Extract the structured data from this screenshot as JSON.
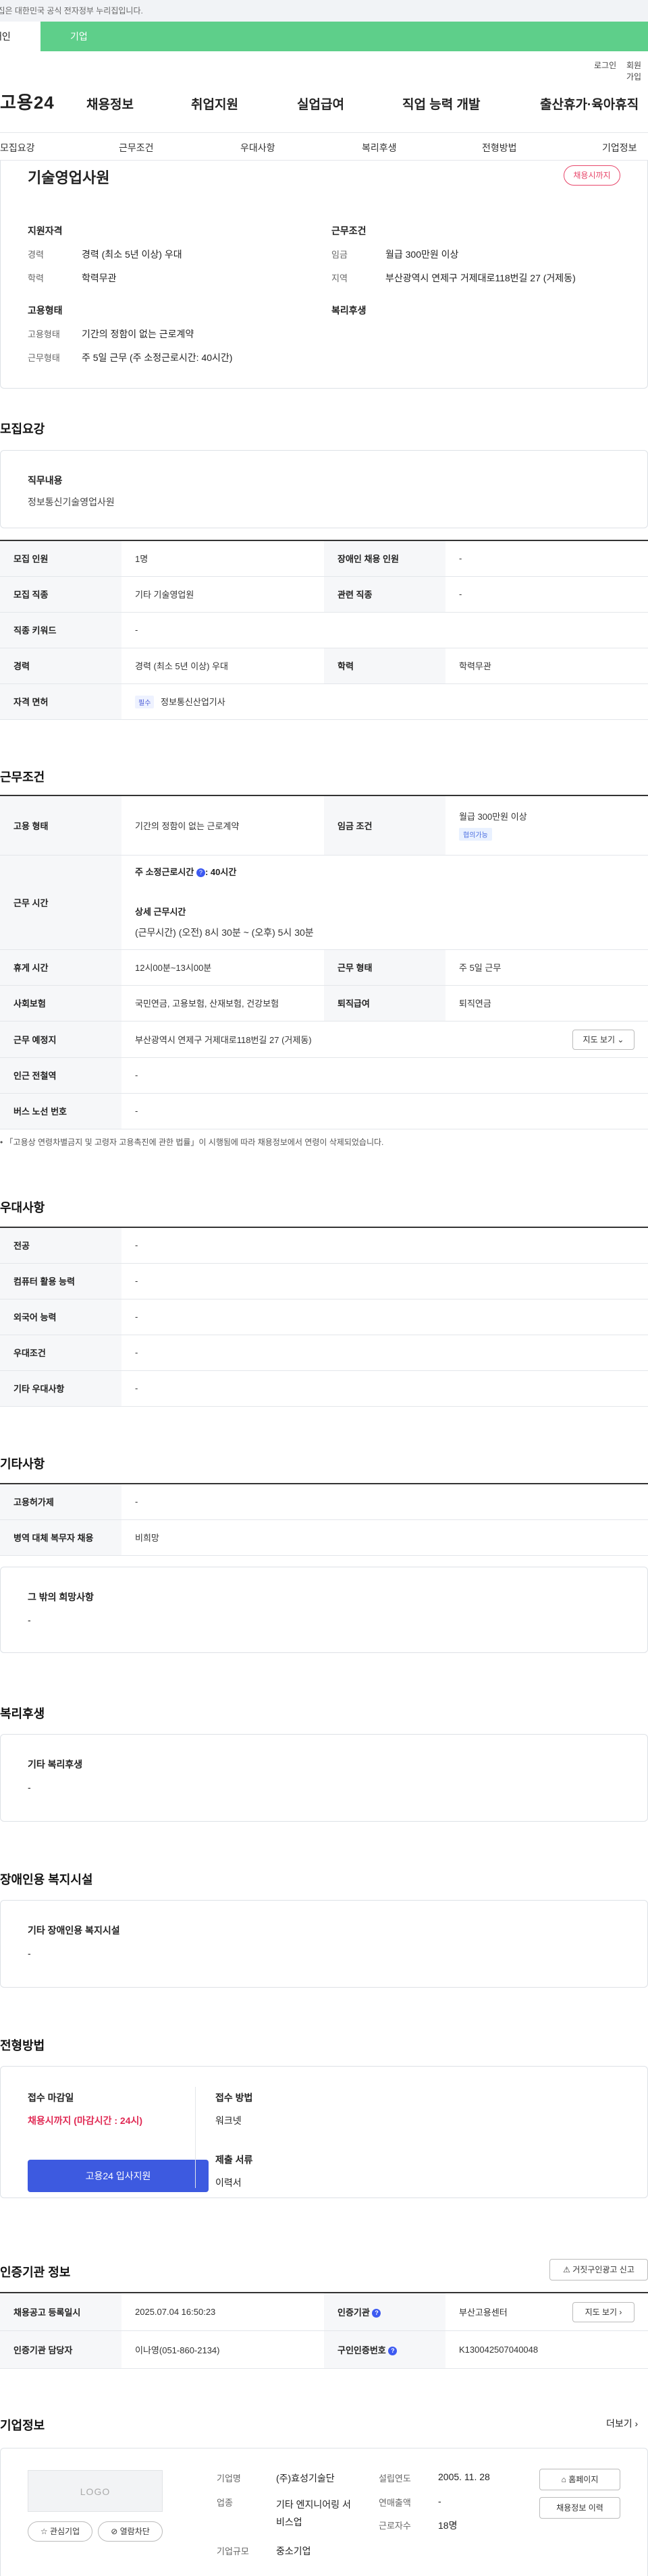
{
  "top": {
    "notice": "이 누리집은 대한민국 공식 전자정부 누리집입니다.",
    "switch_left": "개인",
    "switch_right": "기업"
  },
  "util": {
    "login": "로그인",
    "join": "회원가입"
  },
  "header": {
    "logo": "고용24",
    "nav": [
      "채용정보",
      "취업지원",
      "실업급여",
      "직업 능력 개발",
      "출산휴가·육아휴직"
    ]
  },
  "subnav": [
    "모집요강",
    "근무조건",
    "우대사항",
    "복리후생",
    "전형방법",
    "기업정보"
  ],
  "summary": {
    "title": "기술영업사원",
    "status_badge": "채용시까지",
    "qualification_heading": "지원자격",
    "career_label": "경력",
    "career_value": "경력 (최소 5년 이상) 우대",
    "education_label": "학력",
    "education_value": "학력무관",
    "condition_heading": "근무조건",
    "wage_label": "임금",
    "wage_value": "월급 300만원 이상",
    "region_label": "지역",
    "region_value": "부산광역시 연제구 거제대로118번길 27 (거제동)",
    "employment_heading": "고용형태",
    "emp_type_label": "고용형태",
    "emp_type_value": "기간의 정함이 없는 근로계약",
    "work_type_label": "근무형태",
    "work_type_value": "주 5일 근무 (주 소정근로시간: 40시간)",
    "welfare_heading": "복리후생"
  },
  "recruit": {
    "heading": "모집요강",
    "duty_heading": "직무내용",
    "duty_value": "정보통신기술영업사원",
    "rows": {
      "headcount_label": "모집 인원",
      "headcount_value": "1명",
      "disabled_label": "장애인 채용 인원",
      "disabled_value": "-",
      "job_label": "모집 직종",
      "job_value": "기타 기술영업원",
      "related_label": "관련 직종",
      "related_value": "-",
      "keyword_label": "직종 키워드",
      "keyword_value": "-",
      "career_label": "경력",
      "career_value": "경력 (최소 5년 이상) 우대",
      "edu_label": "학력",
      "edu_value": "학력무관",
      "license_label": "자격 면허",
      "license_badge": "필수",
      "license_value": "정보통신산업기사"
    }
  },
  "work": {
    "heading": "근무조건",
    "emp_label": "고용 형태",
    "emp_value": "기간의 정함이 없는 근로계약",
    "wage_label": "임금 조건",
    "wage_value": "월급 300만원 이상",
    "wage_badge": "협의가능",
    "hours_label": "근무 시간",
    "hours_week_label": "주 소정근로시간",
    "hours_week_value": ": 40시간",
    "hours_detail_label": "상세 근무시간",
    "hours_detail_value": "(근무시간) (오전) 8시 30분 ~ (오후) 5시 30분",
    "break_label": "휴게 시간",
    "break_value": "12시00분~13시00분",
    "form_label": "근무 형태",
    "form_value": "주 5일 근무",
    "insurance_label": "사회보험",
    "insurance_value": "국민연금, 고용보험, 산재보험, 건강보험",
    "retire_label": "퇴직급여",
    "retire_value": "퇴직연금",
    "place_label": "근무 예정지",
    "place_value": "부산광역시 연제구 거제대로118번길 27 (거제동)",
    "map_button": "지도 보기",
    "subway_label": "인근 전철역",
    "subway_value": "-",
    "bus_label": "버스 노선 번호",
    "bus_value": "-",
    "note": "「고용상 연령차별금지 및 고령자 고용촉진에 관한 법률」이 시행됨에 따라 채용정보에서 연령이 삭제되었습니다."
  },
  "pref": {
    "heading": "우대사항",
    "rows": [
      {
        "label": "전공",
        "value": "-"
      },
      {
        "label": "컴퓨터 활용 능력",
        "value": "-"
      },
      {
        "label": "외국어 능력",
        "value": "-"
      },
      {
        "label": "우대조건",
        "value": "-"
      },
      {
        "label": "기타 우대사항",
        "value": "-"
      }
    ]
  },
  "etc": {
    "heading": "기타사항",
    "foreign_label": "고용허가제",
    "foreign_value": "-",
    "military_label": "병역 대체 복무자 채용",
    "military_value": "비희망",
    "other_heading": "그 밖의 희망사항",
    "other_value": "-"
  },
  "welfare": {
    "heading": "복리후생",
    "sub": "기타 복리후생",
    "value": "-"
  },
  "facility": {
    "heading": "장애인용 복지시설",
    "sub": "기타 장애인용 복지시설",
    "value": "-"
  },
  "process": {
    "heading": "전형방법",
    "deadline_label": "접수 마감일",
    "deadline_value": "채용시까지 (마감시간 : 24시)",
    "apply_button": "고용24 입사지원",
    "method_label": "접수 방법",
    "method_value": "워크넷",
    "docs_label": "제출 서류",
    "docs_value": "이력서"
  },
  "agency": {
    "heading": "인증기관 정보",
    "report_button": "거짓구인광고 신고",
    "date_label": "채용공고 등록일시",
    "date_value": "2025.07.04 16:50:23",
    "org_label": "인증기관",
    "org_value": "부산고용센터",
    "map_button": "지도 보기",
    "manager_label": "인증기관 담당자",
    "manager_value": "이나영(051-860-2134)",
    "id_label": "구인인증번호",
    "id_value": "K130042507040048"
  },
  "company": {
    "heading": "기업정보",
    "more": "더보기",
    "logo_text": "LOGO",
    "fav_button": "관심기업",
    "block_button": "열람차단",
    "name_label": "기업명",
    "name_value": "(주)효성기술단",
    "industry_label": "업종",
    "industry_value": "기타 엔지니어링 서비스업",
    "size_label": "기업규모",
    "size_value": "중소기업",
    "founded_label": "설립연도",
    "founded_value": "2005. 11. 28",
    "sales_label": "연매출액",
    "sales_value": "-",
    "staff_label": "근로자수",
    "staff_value": "18명",
    "home_button": "홈페이지",
    "history_button": "채용정보 이력"
  }
}
